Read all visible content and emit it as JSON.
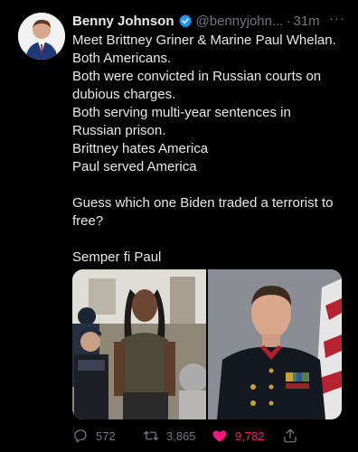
{
  "author": {
    "name": "Benny Johnson",
    "handle": "@bennyjohn...",
    "separator": "·",
    "time": "31m"
  },
  "more_label": "···",
  "tweet": {
    "lines": [
      "Meet Brittney Griner & Marine Paul Whelan.",
      "Both Americans.",
      "Both were convicted in Russian courts on",
      "dubious charges.",
      "Both serving multi-year sentences in",
      "Russian prison.",
      "Brittney hates America",
      "Paul served America"
    ],
    "question_lines": [
      "Guess which one Biden traded a terrorist to",
      "free?"
    ],
    "closing": "Semper fi Paul"
  },
  "actions": {
    "replies": "572",
    "retweets": "3,865",
    "likes": "9,782"
  },
  "colors": {
    "background": "#000000",
    "text": "#e7e9ea",
    "muted": "#71767b",
    "verified": "#1d9bf0",
    "like": "#f91880"
  },
  "icons": {
    "verified": "verified-badge-icon",
    "reply": "reply-icon",
    "retweet": "retweet-icon",
    "like": "heart-icon",
    "share": "share-icon"
  }
}
